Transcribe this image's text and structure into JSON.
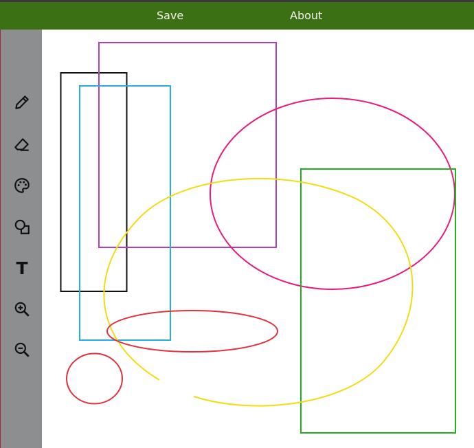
{
  "menu": {
    "save_label": "Save",
    "about_label": "About"
  },
  "toolbar": {
    "tools": [
      {
        "icon": "pencil-icon"
      },
      {
        "icon": "eraser-icon"
      },
      {
        "icon": "palette-icon"
      },
      {
        "icon": "shapes-icon"
      },
      {
        "icon": "text-tool-icon",
        "label": "T"
      },
      {
        "icon": "zoom-in-icon"
      },
      {
        "icon": "zoom-out-icon"
      }
    ]
  },
  "colors": {
    "header": "#3c7014",
    "sidebar": "#8d8e8f",
    "canvas": "#ffffff",
    "shape_black": "#111111",
    "shape_purple": "#b140b8",
    "shape_cyan": "#2bace0",
    "shape_magenta": "#ea1b7e",
    "shape_green": "#22b021",
    "shape_yellow": "#f2dc14",
    "shape_red": "#e2323d"
  }
}
